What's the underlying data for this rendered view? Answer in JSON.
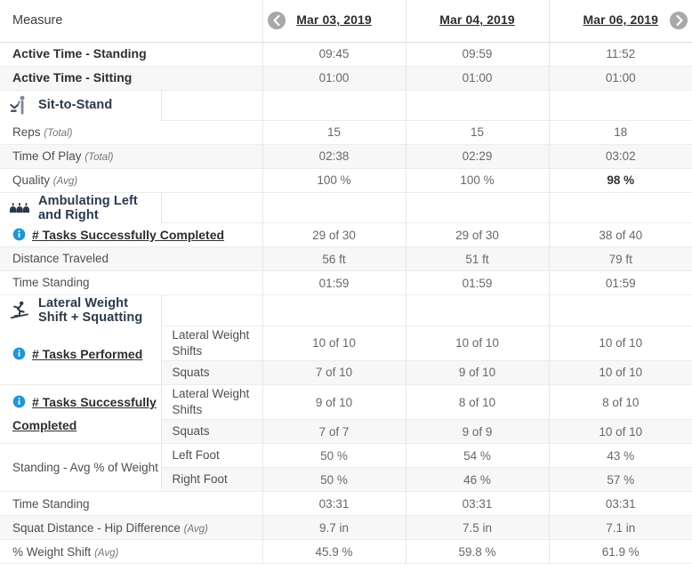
{
  "header": {
    "measure_label": "Measure",
    "prev_icon": "chevron-left-icon",
    "next_icon": "chevron-right-icon",
    "dates": [
      "Mar 03, 2019",
      "Mar 04, 2019",
      "Mar 06, 2019"
    ]
  },
  "top_rows": [
    {
      "label": "Active Time - Standing",
      "values": [
        "09:45",
        "09:59",
        "11:52"
      ]
    },
    {
      "label": "Active Time - Sitting",
      "values": [
        "01:00",
        "01:00",
        "01:00"
      ]
    }
  ],
  "sections": [
    {
      "id": "sit-to-stand",
      "title": "Sit-to-Stand",
      "icon": "sit-to-stand-icon",
      "rows": [
        {
          "label": "Reps",
          "qualifier": "(Total)",
          "values": [
            "15",
            "15",
            "18"
          ]
        },
        {
          "label": "Time Of Play",
          "qualifier": "(Total)",
          "values": [
            "02:38",
            "02:29",
            "03:02"
          ]
        },
        {
          "label": "Quality",
          "qualifier": "(Avg)",
          "values": [
            "100 %",
            "100 %",
            "98 %"
          ],
          "bold_values": [
            false,
            false,
            true
          ]
        }
      ]
    },
    {
      "id": "ambulating",
      "title": "Ambulating Left and Right",
      "icon": "ambulating-icon",
      "rows": [
        {
          "label": "# Tasks Successfully Completed",
          "link": true,
          "info": true,
          "values": [
            "29 of 30",
            "29 of 30",
            "38 of 40"
          ]
        },
        {
          "label": "Distance Traveled",
          "values": [
            "56 ft",
            "51 ft",
            "79 ft"
          ]
        },
        {
          "label": "Time Standing",
          "values": [
            "01:59",
            "01:59",
            "01:59"
          ]
        }
      ]
    },
    {
      "id": "lateral-weight-shift-squatting",
      "title": "Lateral Weight Shift +  Squatting",
      "icon": "lateral-shift-icon",
      "groups": [
        {
          "label": "# Tasks Performed",
          "link": true,
          "info": true,
          "subrows": [
            {
              "sublabel": "Lateral Weight Shifts",
              "values": [
                "10 of 10",
                "10 of 10",
                "10 of 10"
              ]
            },
            {
              "sublabel": "Squats",
              "values": [
                "7 of 10",
                "9 of 10",
                "10 of 10"
              ]
            }
          ]
        },
        {
          "label": "# Tasks Successfully Completed",
          "link": true,
          "info": true,
          "subrows": [
            {
              "sublabel": "Lateral Weight Shifts",
              "values": [
                "9 of 10",
                "8 of 10",
                "8 of 10"
              ]
            },
            {
              "sublabel": "Squats",
              "values": [
                "7 of 7",
                "9 of 9",
                "10 of 10"
              ]
            }
          ]
        },
        {
          "label": "Standing - Avg % of Weight",
          "link": false,
          "info": false,
          "subrows": [
            {
              "sublabel": "Left Foot",
              "values": [
                "50 %",
                "54 %",
                "43 %"
              ]
            },
            {
              "sublabel": "Right Foot",
              "values": [
                "50 %",
                "46 %",
                "57 %"
              ]
            }
          ]
        }
      ],
      "rows": [
        {
          "label": "Time Standing",
          "values": [
            "03:31",
            "03:31",
            "03:31"
          ]
        },
        {
          "label": "Squat Distance - Hip Difference",
          "qualifier": "(Avg)",
          "values": [
            "9.7 in",
            "7.5 in",
            "7.1 in"
          ]
        },
        {
          "label": "% Weight Shift",
          "qualifier": "(Avg)",
          "values": [
            "45.9 %",
            "59.8 %",
            "61.9 %"
          ]
        }
      ]
    }
  ],
  "colors": {
    "info_blue": "#2196d6",
    "section_title": "#2b3a4a",
    "nav_grey": "#a8a8a8",
    "row_alt": "#f7f7f7",
    "value_text": "#63696f"
  }
}
